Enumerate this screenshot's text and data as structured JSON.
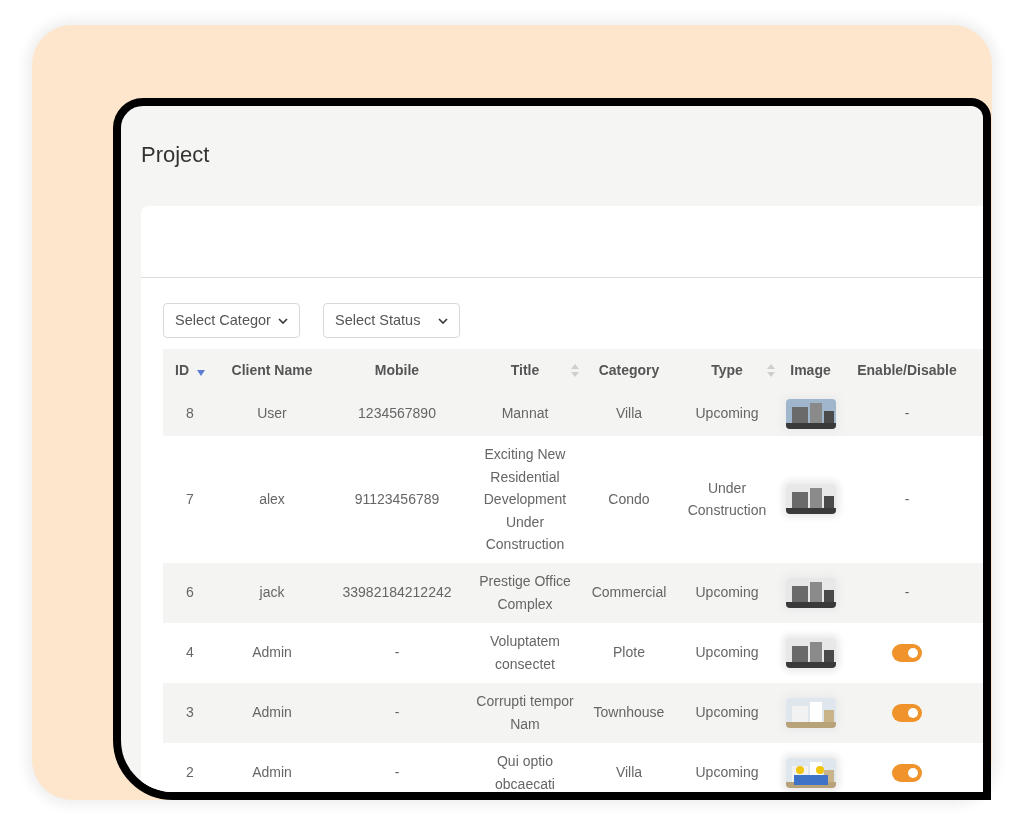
{
  "page": {
    "title": "Project"
  },
  "filters": [
    {
      "label": "Select Categor"
    },
    {
      "label": "Select Status"
    }
  ],
  "table": {
    "columns": [
      {
        "label": "ID",
        "sortable": true,
        "sorted": true
      },
      {
        "label": "Client Name",
        "sortable": false,
        "sorted": false
      },
      {
        "label": "Mobile",
        "sortable": false,
        "sorted": false
      },
      {
        "label": "Title",
        "sortable": true,
        "sorted": false
      },
      {
        "label": "Category",
        "sortable": false,
        "sorted": false
      },
      {
        "label": "Type",
        "sortable": true,
        "sorted": false
      },
      {
        "label": "Image",
        "sortable": false,
        "sorted": false
      },
      {
        "label": "Enable/Disable",
        "sortable": false,
        "sorted": false
      }
    ],
    "rows": [
      {
        "id": "8",
        "client": "User",
        "mobile": "1234567890",
        "title": "Mannat",
        "category": "Villa",
        "type": "Upcoming",
        "enable": {
          "kind": "text",
          "text": "-"
        }
      },
      {
        "id": "7",
        "client": "alex",
        "mobile": "91123456789",
        "title": "Exciting New Residential Development Under Construction",
        "category": "Condo",
        "type": "Under Construction",
        "enable": {
          "kind": "text",
          "text": "-"
        }
      },
      {
        "id": "6",
        "client": "jack",
        "mobile": "33982184212242",
        "title": "Prestige Office Complex",
        "category": "Commercial",
        "type": "Upcoming",
        "enable": {
          "kind": "text",
          "text": "-"
        }
      },
      {
        "id": "4",
        "client": "Admin",
        "mobile": "-",
        "title": "Voluptatem consectet",
        "category": "Plote",
        "type": "Upcoming",
        "enable": {
          "kind": "toggle",
          "on": true
        }
      },
      {
        "id": "3",
        "client": "Admin",
        "mobile": "-",
        "title": "Corrupti tempor Nam",
        "category": "Townhouse",
        "type": "Upcoming",
        "enable": {
          "kind": "toggle",
          "on": true
        }
      },
      {
        "id": "2",
        "client": "Admin",
        "mobile": "-",
        "title": "Qui optio obcaecati",
        "category": "Villa",
        "type": "Upcoming",
        "enable": {
          "kind": "toggle",
          "on": true
        }
      }
    ]
  }
}
